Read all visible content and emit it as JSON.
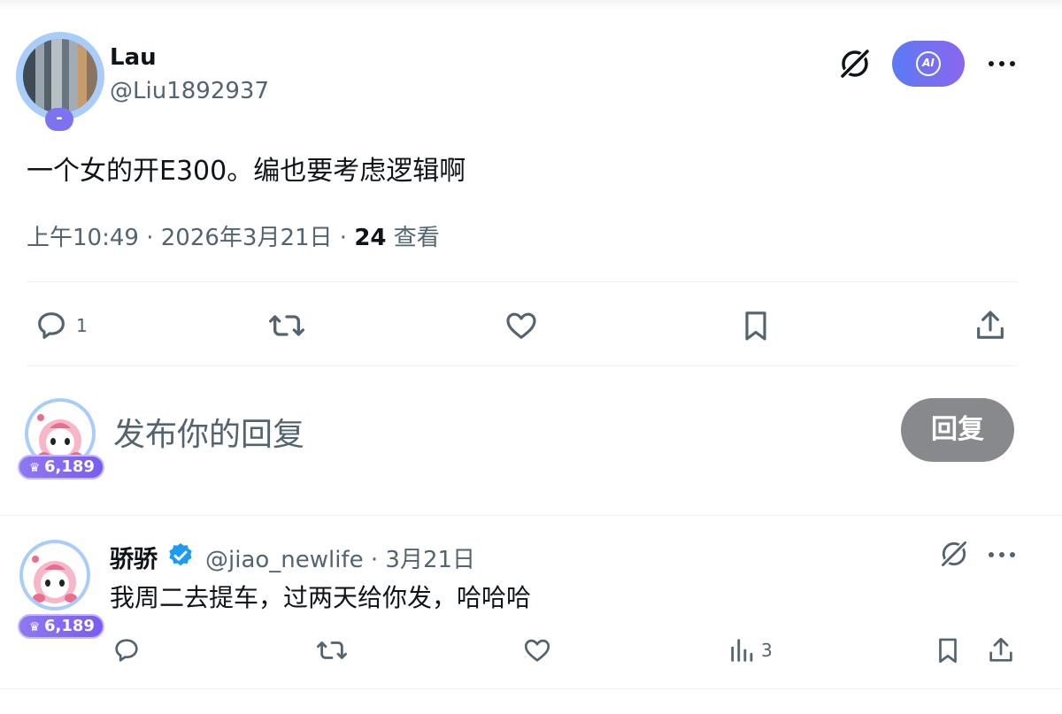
{
  "main_tweet": {
    "author_name": "Lau",
    "author_handle": "@Liu1892937",
    "avatar_badge": "-",
    "ai_label": "AI",
    "text": "一个女的开E300。编也要考虑逻辑啊",
    "time": "上午10:49",
    "date": "2026年3月21日",
    "separator": " · ",
    "views_count": "24",
    "views_label": "查看",
    "actions": {
      "reply_count": "1"
    }
  },
  "composer": {
    "placeholder": "发布你的回复",
    "reply_button": "回复",
    "score": "6,189"
  },
  "reply_tweet": {
    "author_name": "骄骄",
    "handle_and_date": "@jiao_newlife · 3月21日",
    "text": "我周二去提车，过两天给你发，哈哈哈",
    "score": "6,189",
    "analytics_count": "3"
  },
  "colors": {
    "text_primary": "#0f1419",
    "text_secondary": "#536471",
    "verified_blue": "#1d9bf0",
    "ai_gradient_start": "#5b7bf2",
    "ai_gradient_end": "#8b66f0",
    "badge_purple": "#7d73f0",
    "reply_button_bg": "#87898c"
  },
  "icons": [
    "grok-icon",
    "ai-icon",
    "more-icon",
    "reply-icon",
    "retweet-icon",
    "like-icon",
    "bookmark-icon",
    "share-icon",
    "analytics-icon",
    "verified-icon",
    "trophy-icon"
  ]
}
